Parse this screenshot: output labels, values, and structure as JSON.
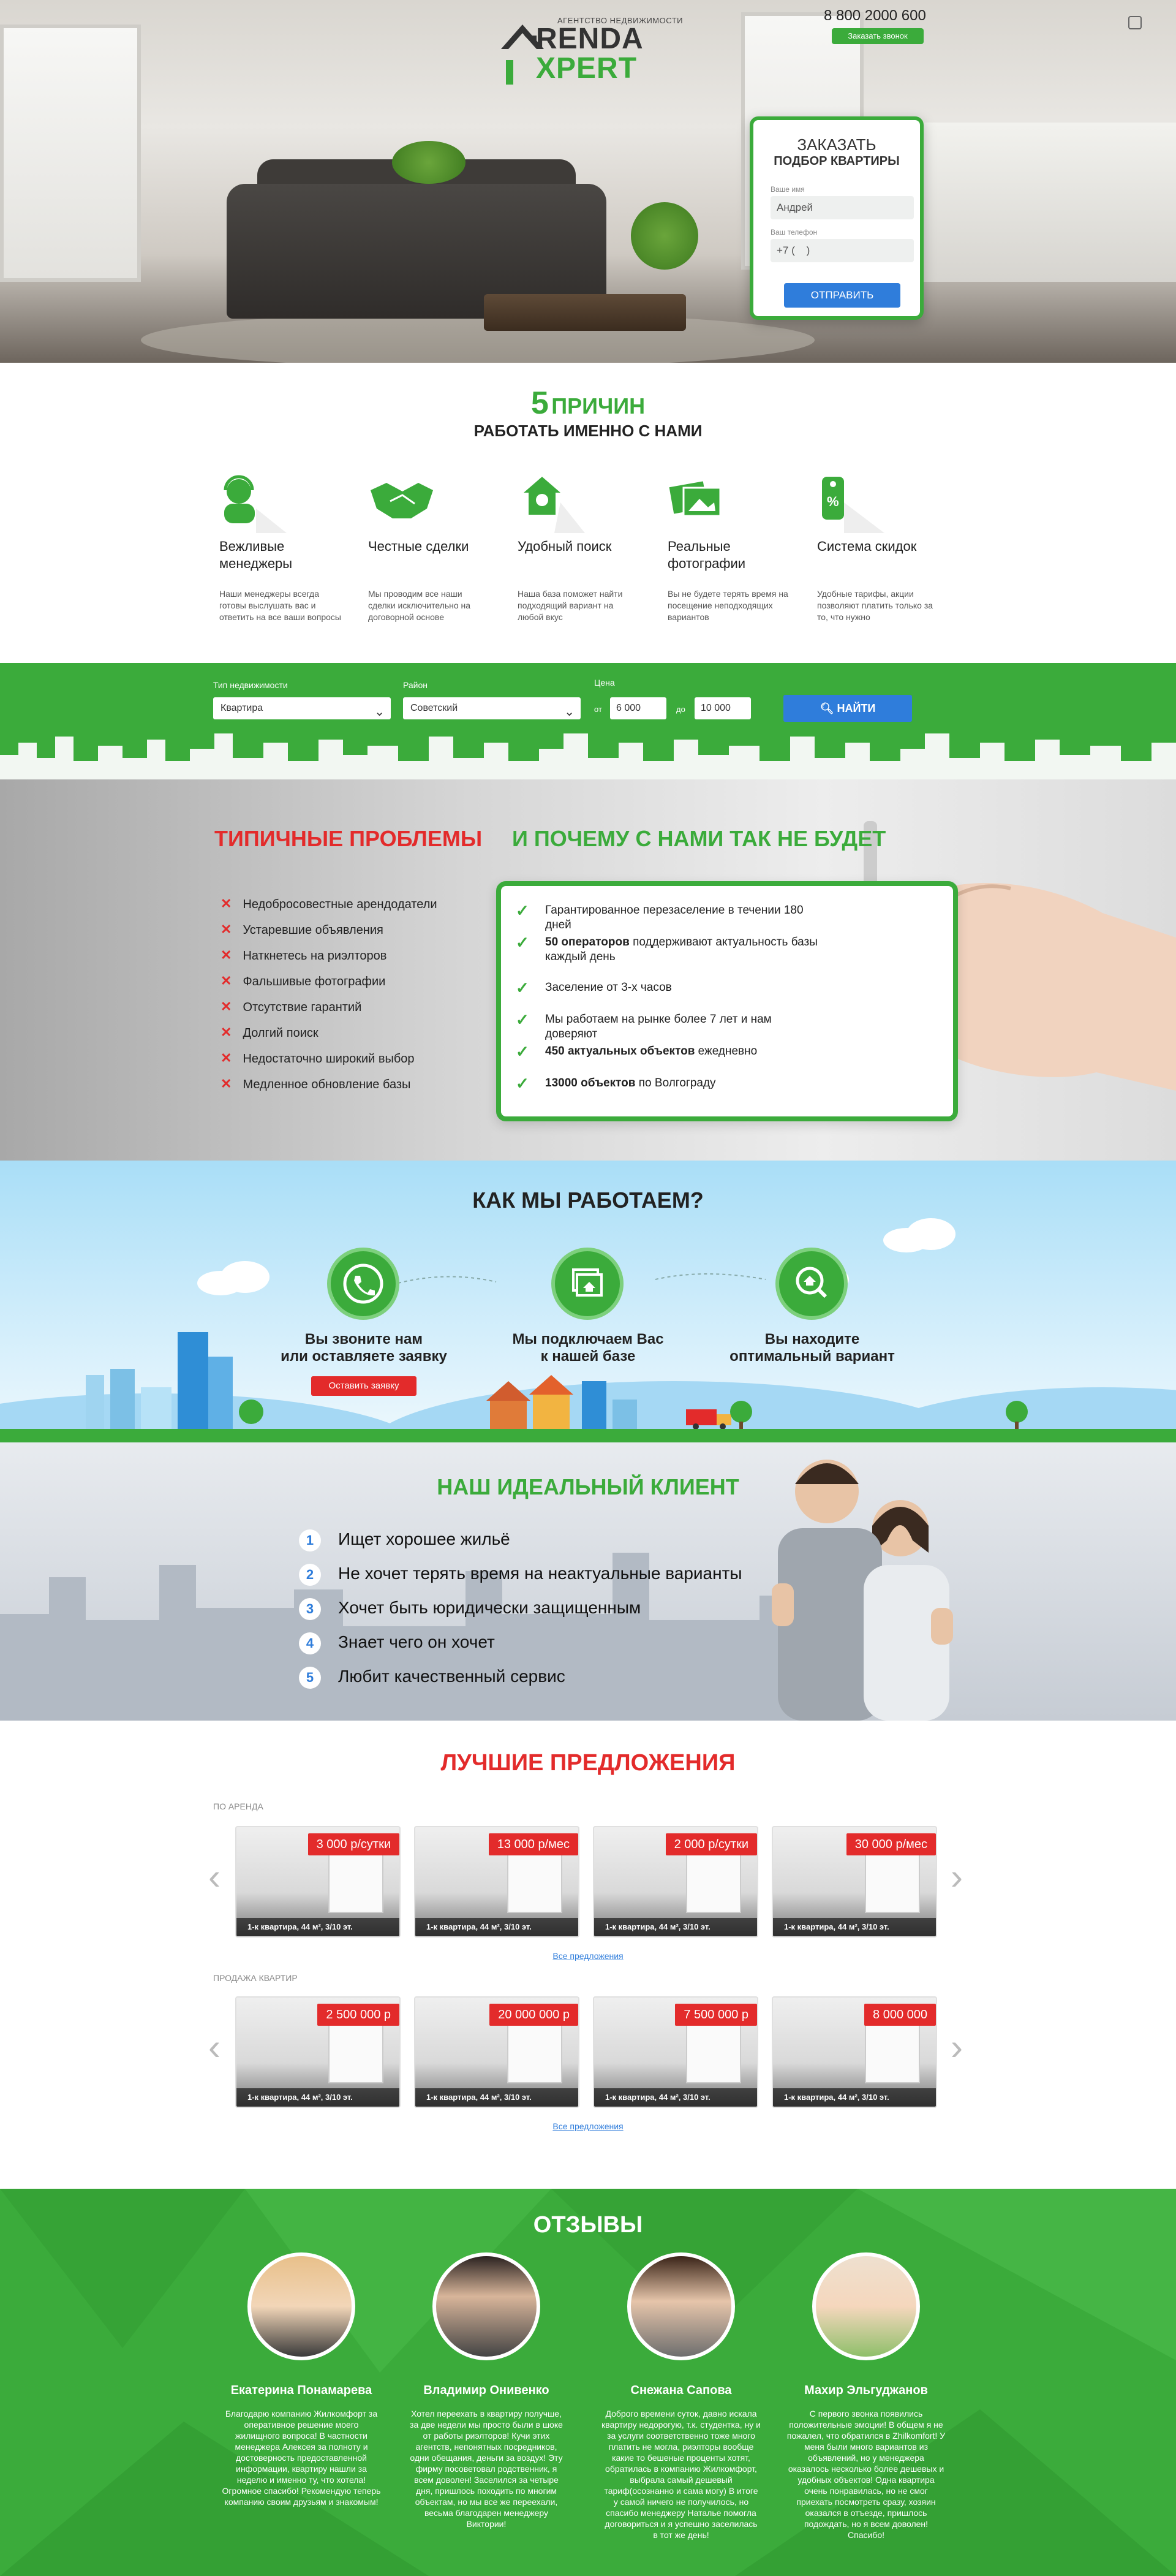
{
  "header": {
    "logo_sub": "АГЕНТСТВО НЕДВИЖИМОСТИ",
    "logo_line1": "RENDA",
    "logo_line2": "XPERT",
    "phone": "8 800 2000 600",
    "call_button": "Заказать звонок"
  },
  "order_form": {
    "title": "ЗАКАЗАТЬ",
    "subtitle": "ПОДБОР КВАРТИРЫ",
    "name_label": "Ваше имя",
    "name_value": "Андрей",
    "phone_label": "Ваш телефон",
    "phone_value": "+7 (    )",
    "submit": "ОТПРАВИТЬ"
  },
  "reasons": {
    "number": "5",
    "title1": "ПРИЧИН",
    "title2": "РАБОТАТЬ ИМЕННО С НАМИ",
    "items": [
      {
        "name": "Вежливые менеджеры",
        "desc": "Наши менеджеры всегда готовы выслушать вас и ответить на все ваши вопросы",
        "icon": "headset-icon"
      },
      {
        "name": "Честные сделки",
        "desc": "Мы проводим все наши сделки исключительно на договорной основе",
        "icon": "handshake-icon"
      },
      {
        "name": "Удобный поиск",
        "desc": "Наша база поможет найти подходящий вариант на любой вкус",
        "icon": "house-search-icon"
      },
      {
        "name": "Реальные фотографии",
        "desc": "Вы не будете терять время на посещение неподходящих вариантов",
        "icon": "photos-icon"
      },
      {
        "name": "Система скидок",
        "desc": "Удобные тарифы, акции позволяют платить только за то, что нужно",
        "icon": "discount-tag-icon"
      }
    ]
  },
  "search": {
    "type_label": "Тип недвижимости",
    "type_value": "Квартира",
    "district_label": "Район",
    "district_value": "Советский",
    "price_label": "Цена",
    "from_label": "от",
    "from_value": "6 000",
    "to_label": "до",
    "to_value": "10 000",
    "button": "НАЙТИ"
  },
  "problems": {
    "title": "ТИПИЧНЫЕ ПРОБЛЕМЫ",
    "items": [
      "Недобросовестные арендодатели",
      "Устаревшие объявления",
      "Наткнетесь на риэлторов",
      "Фальшивые фотографии",
      "Отсутствие гарантий",
      "Долгий поиск",
      "Недостаточно широкий выбор",
      "Медленное обновление базы"
    ]
  },
  "why": {
    "title": "И ПОЧЕМУ С НАМИ ТАК НЕ БУДЕТ",
    "items": [
      {
        "bold": "",
        "text": "Гарантированное перезаселение в течении 180 дней"
      },
      {
        "bold": "50 операторов",
        "text": " поддерживают актуальность базы каждый день"
      },
      {
        "bold": "",
        "text": "Заселение от 3-х часов"
      },
      {
        "bold": "",
        "text": "Мы работаем на рынке более 7 лет и нам доверяют"
      },
      {
        "bold": "450 актуальных объектов",
        "text": " ежедневно"
      },
      {
        "bold": "13000 объектов",
        "text": " по Волгограду"
      }
    ]
  },
  "how": {
    "title": "КАК МЫ РАБОТАЕМ?",
    "steps": [
      {
        "text1": "Вы звоните нам",
        "text2": "или оставляете заявку",
        "icon": "phone-icon"
      },
      {
        "text1": "Мы подключаем Вас",
        "text2": "к нашей базе",
        "icon": "database-icon"
      },
      {
        "text1": "Вы находите",
        "text2": "оптимальный вариант",
        "icon": "search-house-icon"
      }
    ],
    "leave_button": "Оставить заявку"
  },
  "client": {
    "title": "НАШ ИДЕАЛЬНЫЙ КЛИЕНТ",
    "items": [
      {
        "n": "1",
        "text": "Ищет хорошее жильё"
      },
      {
        "n": "2",
        "text": "Не хочет терять время на неактуальные варианты"
      },
      {
        "n": "3",
        "text": "Хочет быть юридически защищенным"
      },
      {
        "n": "4",
        "text": "Знает чего он хочет"
      },
      {
        "n": "5",
        "text": "Любит качественный сервис"
      }
    ]
  },
  "best": {
    "title": "ЛУЧШИЕ ПРЕДЛОЖЕНИЯ",
    "rent_label": "ПО АРЕНДА",
    "rent_cards": [
      {
        "price": "3 000 р/сутки",
        "caption": "1-к квартира, 44 м², 3/10 эт."
      },
      {
        "price": "13 000 р/мес",
        "caption": "1-к квартира, 44 м², 3/10 эт."
      },
      {
        "price": "2 000 р/сутки",
        "caption": "1-к квартира, 44 м², 3/10 эт."
      },
      {
        "price": "30 000 р/мес",
        "caption": "1-к квартира, 44 м², 3/10 эт."
      }
    ],
    "all_link": "Все предложения",
    "sale_label": "ПРОДАЖА КВАРТИР",
    "sale_cards": [
      {
        "price": "2 500 000 р",
        "caption": "1-к квартира, 44 м², 3/10 эт."
      },
      {
        "price": "20 000 000 р",
        "caption": "1-к квартира, 44 м², 3/10 эт."
      },
      {
        "price": "7 500 000 р",
        "caption": "1-к квартира, 44 м², 3/10 эт."
      },
      {
        "price": "8 000 000",
        "caption": "1-к квартира, 44 м², 3/10 эт."
      }
    ],
    "prev": "‹",
    "next": "›"
  },
  "reviews": {
    "title": "ОТЗЫВЫ",
    "items": [
      {
        "name": "Екатерина Понамарева",
        "text": "Благодарю компанию Жилкомфорт за оперативное решение моего жилищного вопроса! В частности менеджера Алексея за полноту и достоверность предоставленной информации, квартиру нашли за неделю и именно ту, что хотела! Огромное спасибо! Рекомендую теперь компанию своим друзьям и знакомым!"
      },
      {
        "name": "Владимир Онивенко",
        "text": "Хотел переехать в квартиру получше, за две недели мы просто были в шоке от работы риэлторов! Кучи этих агентств, непонятных посредников, одни обещания, деньги за воздух! Эту фирму посоветовал родственник, я всем доволен! Заселился за четыре дня, пришлось походить по многим объектам, но мы все же переехали, весьма благодарен менеджеру Виктории!"
      },
      {
        "name": "Снежана Сапова",
        "text": "Доброго времени суток, давно искала квартиру недорогую, т.к. студентка, ну и за услуги соответственно тоже много платить не могла, риэлторы вообще какие то бешеные проценты хотят, обратилась в компанию Жилкомфорт, выбрала самый дешевый тариф(осознанно и сама могу) В итоге у самой ничего не получилось, но спасибо менеджеру Наталье помогла договориться и я успешно заселилась в тот же день!"
      },
      {
        "name": "Махир Эльгуджанов",
        "text": "С первого звонка появились положительные эмоции! В общем я не пожалел, что обратился в Zhilkomfort! У меня были много вариантов из объявлений, но у менеджера оказалось несколько более дешевых и удобных объектов! Одна квартира очень понравилась, но не смог приехать посмотреть сразу, хозяин оказался в отъезде, пришлось подождать, но я всем доволен! Спасибо!"
      }
    ]
  }
}
